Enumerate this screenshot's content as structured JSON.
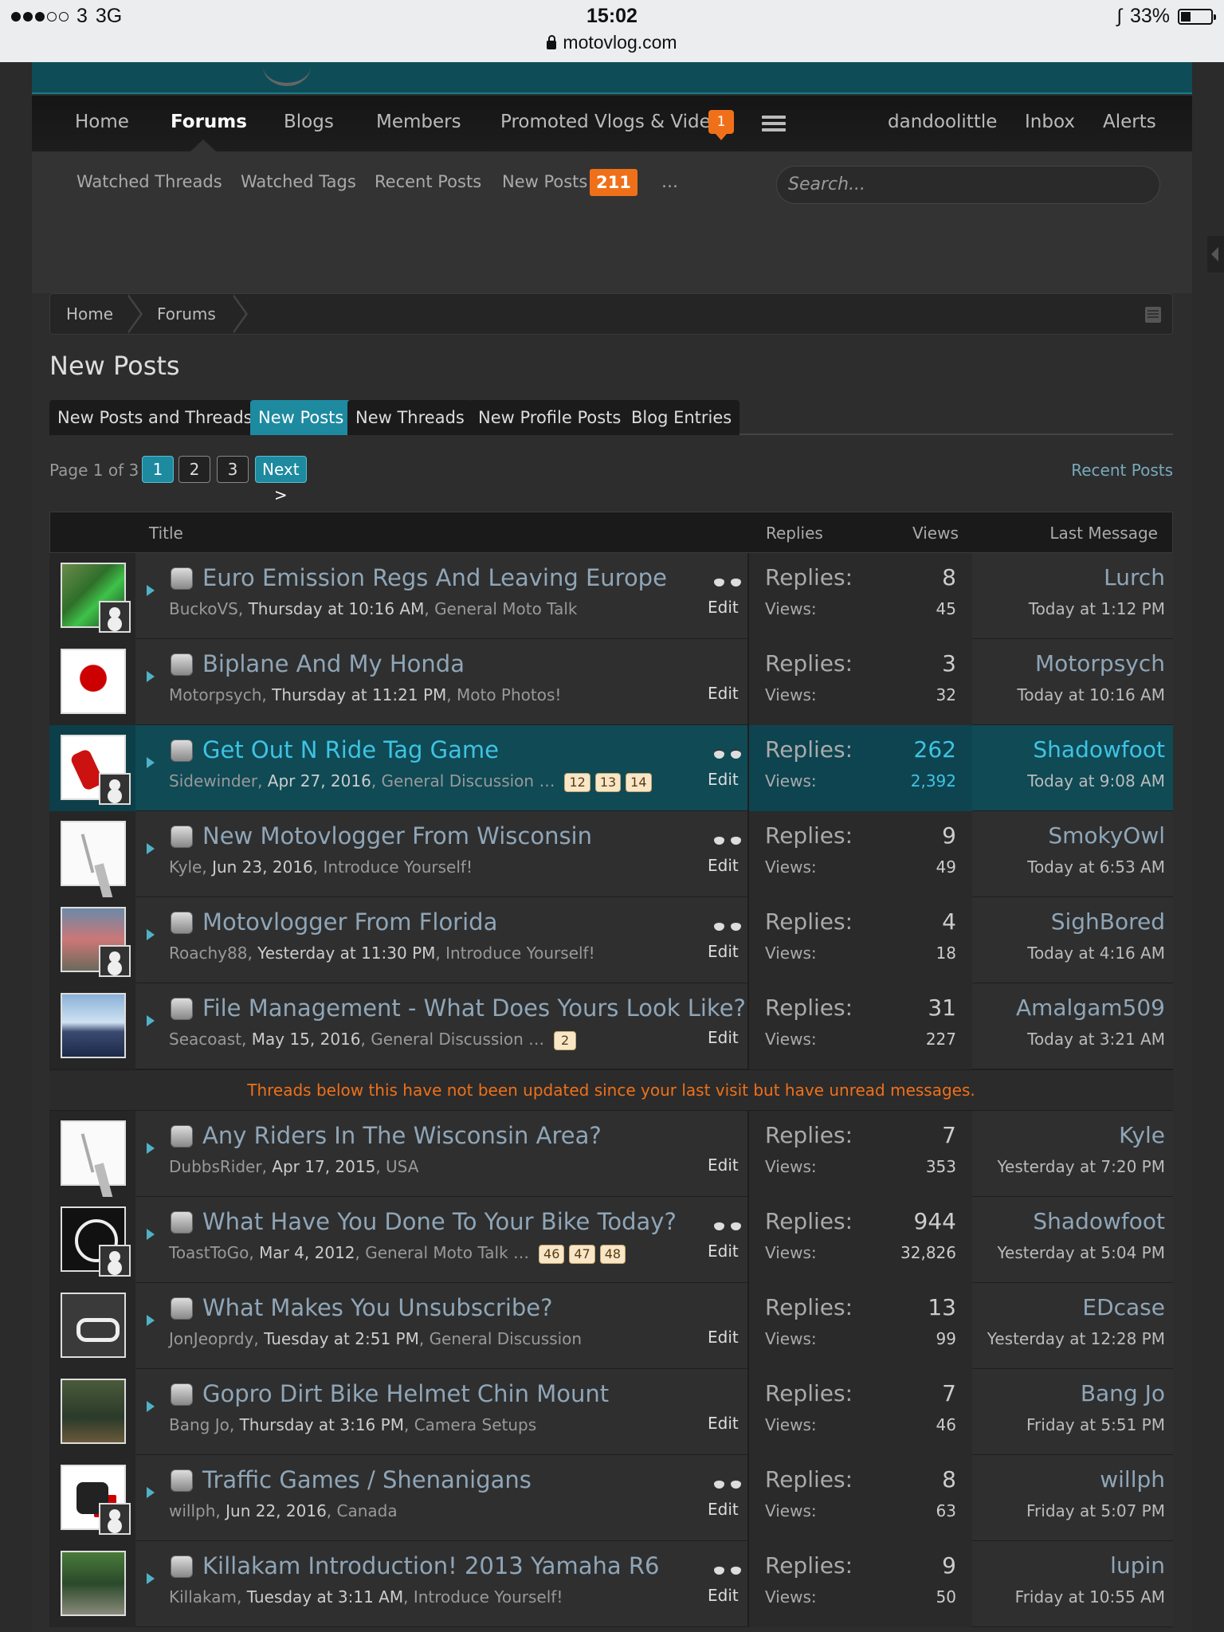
{
  "status_bar": {
    "carrier": "3",
    "network": "3G",
    "time": "15:02",
    "url": "motovlog.com",
    "battery": "33%",
    "battery_level": 0.33,
    "signal_bars": 3
  },
  "nav": {
    "items": [
      "Home",
      "Forums",
      "Blogs",
      "Members",
      "Promoted Vlogs & Videos"
    ],
    "active": "Forums",
    "user": "dandoolittle",
    "inbox": "Inbox",
    "alerts": "Alerts",
    "alert_count": "1"
  },
  "subnav": {
    "watched_threads": "Watched Threads",
    "watched_tags": "Watched Tags",
    "recent_posts": "Recent Posts",
    "new_posts": "New Posts",
    "new_posts_count": "211",
    "more": "…",
    "search_placeholder": "Search..."
  },
  "breadcrumb": [
    "Home",
    "Forums"
  ],
  "page_title": "New Posts",
  "tabs": [
    "New Posts and Threads",
    "New Posts",
    "New Threads",
    "New Profile Posts",
    "Blog Entries"
  ],
  "active_tab": "New Posts",
  "pager": {
    "label": "Page 1 of 3",
    "pages": [
      "1",
      "2",
      "3"
    ],
    "current": "1",
    "next": "Next >",
    "recent_posts_link": "Recent Posts"
  },
  "table": {
    "headers": {
      "title": "Title",
      "replies": "Replies",
      "views": "Views",
      "last_message": "Last Message"
    },
    "replies_label": "Replies:",
    "views_label": "Views:",
    "edit_label": "Edit",
    "notice": "Threads below this have not been updated since your last visit but have unread messages.",
    "threads": [
      {
        "title": "Euro Emission Regs And Leaving Europe",
        "author": "BuckoVS",
        "date": "Thursday at 10:16 AM",
        "forum": "General Moto Talk",
        "replies": "8",
        "views": "45",
        "last_user": "Lurch",
        "last_date": "Today at 1:12 PM",
        "watched": true,
        "pages": [],
        "sticky": false
      },
      {
        "title": "Biplane And My Honda",
        "author": "Motorpsych",
        "date": "Thursday at 11:21 PM",
        "forum": "Moto Photos!",
        "replies": "3",
        "views": "32",
        "last_user": "Motorpsych",
        "last_date": "Today at 10:16 AM",
        "watched": false,
        "pages": [],
        "sticky": false
      },
      {
        "title": "Get Out N Ride Tag Game",
        "author": "Sidewinder",
        "date": "Apr 27, 2016",
        "forum": "General Discussion",
        "replies": "262",
        "views": "2,392",
        "last_user": "Shadowfoot",
        "last_date": "Today at 9:08 AM",
        "watched": true,
        "pages": [
          "12",
          "13",
          "14"
        ],
        "sticky": true
      },
      {
        "title": "New Motovlogger From Wisconsin",
        "author": "Kyle",
        "date": "Jun 23, 2016",
        "forum": "Introduce Yourself!",
        "replies": "9",
        "views": "49",
        "last_user": "SmokyOwl",
        "last_date": "Today at 6:53 AM",
        "watched": true,
        "pages": [],
        "sticky": false
      },
      {
        "title": "Motovlogger From Florida",
        "author": "Roachy88",
        "date": "Yesterday at 11:30 PM",
        "forum": "Introduce Yourself!",
        "replies": "4",
        "views": "18",
        "last_user": "SighBored",
        "last_date": "Today at 4:16 AM",
        "watched": true,
        "pages": [],
        "sticky": false
      },
      {
        "title": "File Management - What Does Yours Look Like?",
        "author": "Seacoast",
        "date": "May 15, 2016",
        "forum": "General Discussion",
        "replies": "31",
        "views": "227",
        "last_user": "Amalgam509",
        "last_date": "Today at 3:21 AM",
        "watched": false,
        "pages": [
          "2"
        ],
        "sticky": false
      },
      {
        "title": "Any Riders In The Wisconsin Area?",
        "author": "DubbsRider",
        "date": "Apr 17, 2015",
        "forum": "USA",
        "replies": "7",
        "views": "353",
        "last_user": "Kyle",
        "last_date": "Yesterday at 7:20 PM",
        "watched": false,
        "pages": [],
        "sticky": false
      },
      {
        "title": "What Have You Done To Your Bike Today?",
        "author": "ToastToGo",
        "date": "Mar 4, 2012",
        "forum": "General Moto Talk",
        "replies": "944",
        "views": "32,826",
        "last_user": "Shadowfoot",
        "last_date": "Yesterday at 5:04 PM",
        "watched": true,
        "pages": [
          "46",
          "47",
          "48"
        ],
        "sticky": false
      },
      {
        "title": "What Makes You Unsubscribe?",
        "author": "JonJeoprdy",
        "date": "Tuesday at 2:51 PM",
        "forum": "General Discussion",
        "replies": "13",
        "views": "99",
        "last_user": "EDcase",
        "last_date": "Yesterday at 12:28 PM",
        "watched": false,
        "pages": [],
        "sticky": false
      },
      {
        "title": "Gopro Dirt Bike Helmet Chin Mount",
        "author": "Bang Jo",
        "date": "Thursday at 3:16 PM",
        "forum": "Camera Setups",
        "replies": "7",
        "views": "46",
        "last_user": "Bang Jo",
        "last_date": "Friday at 5:51 PM",
        "watched": false,
        "pages": [],
        "sticky": false
      },
      {
        "title": "Traffic Games / Shenanigans",
        "author": "willph",
        "date": "Jun 22, 2016",
        "forum": "Canada",
        "replies": "8",
        "views": "63",
        "last_user": "willph",
        "last_date": "Friday at 5:07 PM",
        "watched": true,
        "pages": [],
        "sticky": false
      },
      {
        "title": "Killakam Introduction! 2013 Yamaha R6",
        "author": "Killakam",
        "date": "Tuesday at 3:11 AM",
        "forum": "Introduce Yourself!",
        "replies": "9",
        "views": "50",
        "last_user": "lupin",
        "last_date": "Friday at 10:55 AM",
        "watched": true,
        "pages": [],
        "sticky": false
      }
    ]
  },
  "colors": {
    "accent": "#1d8aa0",
    "badge": "#f07019",
    "sticky_row": "#0f4a55",
    "notice_text": "#f07019"
  }
}
